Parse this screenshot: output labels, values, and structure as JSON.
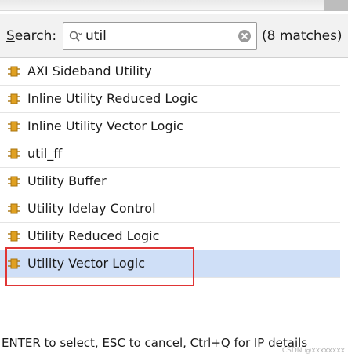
{
  "search": {
    "label_prefix": "S",
    "label_rest": "earch:",
    "value": "util",
    "match_count": "(8 matches)"
  },
  "results": [
    {
      "label": "AXI Sideband Utility"
    },
    {
      "label": "Inline Utility Reduced Logic"
    },
    {
      "label": "Inline Utility Vector Logic"
    },
    {
      "label": "util_ff"
    },
    {
      "label": "Utility Buffer"
    },
    {
      "label": "Utility Idelay Control"
    },
    {
      "label": "Utility Reduced Logic"
    },
    {
      "label": "Utility Vector Logic",
      "selected": true
    }
  ],
  "footer": {
    "hint": "ENTER to select, ESC to cancel, Ctrl+Q for IP details"
  },
  "watermark": "CSDN @xxxxxxxx",
  "colors": {
    "selected_row": "#cfdff7",
    "highlight_box": "#e03535",
    "ip_icon": "#e0a020"
  }
}
